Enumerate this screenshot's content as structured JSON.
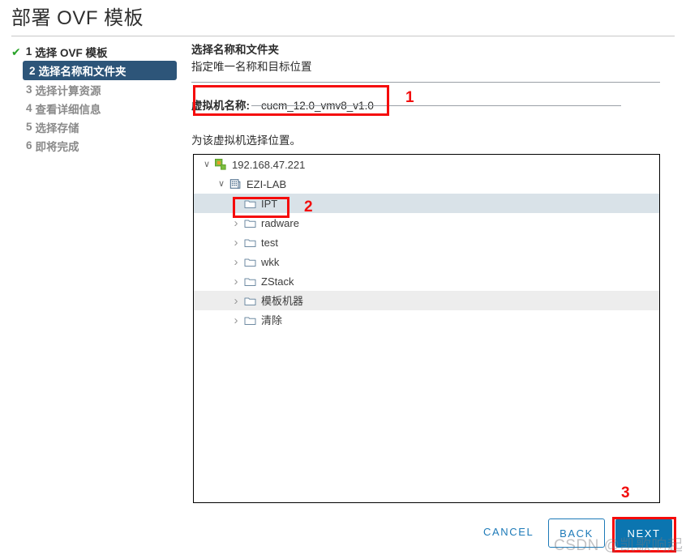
{
  "window": {
    "title": "部署 OVF 模板"
  },
  "steps": [
    {
      "num": "1",
      "label": "选择 OVF 模板",
      "state": "done",
      "icon": "check-icon"
    },
    {
      "num": "2",
      "label": "选择名称和文件夹",
      "state": "active"
    },
    {
      "num": "3",
      "label": "选择计算资源",
      "state": "pending"
    },
    {
      "num": "4",
      "label": "查看详细信息",
      "state": "pending"
    },
    {
      "num": "5",
      "label": "选择存储",
      "state": "pending"
    },
    {
      "num": "6",
      "label": "即将完成",
      "state": "pending"
    }
  ],
  "content": {
    "heading": "选择名称和文件夹",
    "subheading": "指定唯一名称和目标位置",
    "vm_name_label": "虚拟机名称:",
    "vm_name_value": "cucm_12.0_vmv8_v1.0",
    "vm_name_placeholder": "",
    "location_prompt": "为该虚拟机选择位置。"
  },
  "tree": [
    {
      "label": "192.168.47.221",
      "icon": "vcenter-icon",
      "depth": 0,
      "caret": "expanded",
      "state": "normal"
    },
    {
      "label": "EZI-LAB",
      "icon": "datacenter-icon",
      "depth": 1,
      "caret": "expanded",
      "state": "normal"
    },
    {
      "label": "IPT",
      "icon": "folder-icon",
      "depth": 2,
      "caret": "none",
      "state": "selected"
    },
    {
      "label": "radware",
      "icon": "folder-icon",
      "depth": 2,
      "caret": "collapsed",
      "state": "normal"
    },
    {
      "label": "test",
      "icon": "folder-icon",
      "depth": 2,
      "caret": "collapsed",
      "state": "normal"
    },
    {
      "label": "wkk",
      "icon": "folder-icon",
      "depth": 2,
      "caret": "collapsed",
      "state": "normal"
    },
    {
      "label": "ZStack",
      "icon": "folder-icon",
      "depth": 2,
      "caret": "collapsed",
      "state": "normal"
    },
    {
      "label": "模板机器",
      "icon": "folder-icon",
      "depth": 2,
      "caret": "collapsed",
      "state": "hover"
    },
    {
      "label": "清除",
      "icon": "folder-icon",
      "depth": 2,
      "caret": "collapsed",
      "state": "normal"
    }
  ],
  "footer": {
    "cancel_label": "CANCEL",
    "back_label": "BACK",
    "next_label": "NEXT"
  },
  "annotations": [
    {
      "number": "1",
      "target": "vm-name-field"
    },
    {
      "number": "2",
      "target": "tree-item-ipt"
    },
    {
      "number": "3",
      "target": "next-button"
    }
  ],
  "watermark": {
    "text": "CSDN @凯歌响起"
  },
  "colors": {
    "active_step_bg": "#2d5579",
    "check_green": "#29a329",
    "primary_blue": "#0b75b0",
    "link_blue": "#1d7ab8",
    "annotation_red": "#f50b0b",
    "row_selected": "#d9e2e8",
    "row_hover": "#ededed"
  }
}
